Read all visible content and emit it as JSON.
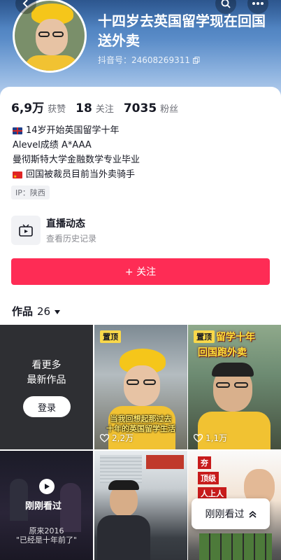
{
  "profile": {
    "name": "十四岁去英国留学现在回国送外卖",
    "douyin_id": "抖音号：24608269311"
  },
  "stats": {
    "likes_value": "6,9万",
    "likes_label": "获赞",
    "following_value": "18",
    "following_label": "关注",
    "followers_value": "7035",
    "followers_label": "粉丝"
  },
  "bio": {
    "line1": "14岁开始英国留学十年",
    "line2": "Alevel成绩 A*AAA",
    "line3": "曼彻斯特大学金融数学专业毕业",
    "line4": "回国被裁员目前当外卖骑手"
  },
  "ip_tag": "IP：陕西",
  "live": {
    "title": "直播动态",
    "subtitle": "查看历史记录"
  },
  "follow_button": "+ 关注",
  "works_tab": {
    "label": "作品",
    "count": "26"
  },
  "grid": {
    "login_prompt_line1": "看更多",
    "login_prompt_line2": "最新作品",
    "login_button": "登录",
    "pin_badge": "置顶",
    "video2_caption_line1": "当我回想起那过去",
    "video2_caption_line2": "十年的英国留学生活",
    "video2_likes": "2,2万",
    "video3_caption_line1": "留学十年",
    "video3_caption_line2": "回国跑外卖",
    "video3_likes": "1,1万",
    "video4_label": "刚刚看过",
    "video4_subtitle_line1": "原来2016",
    "video4_subtitle_line2": "\"已经是十年前了\"",
    "video6_tag1": "夯",
    "video6_tag2": "顶级",
    "video6_tag3": "人上人"
  },
  "float_button": {
    "label": "刚刚看过"
  },
  "colors": {
    "accent": "#fe2c55",
    "pin_badge": "#f9d84a"
  }
}
